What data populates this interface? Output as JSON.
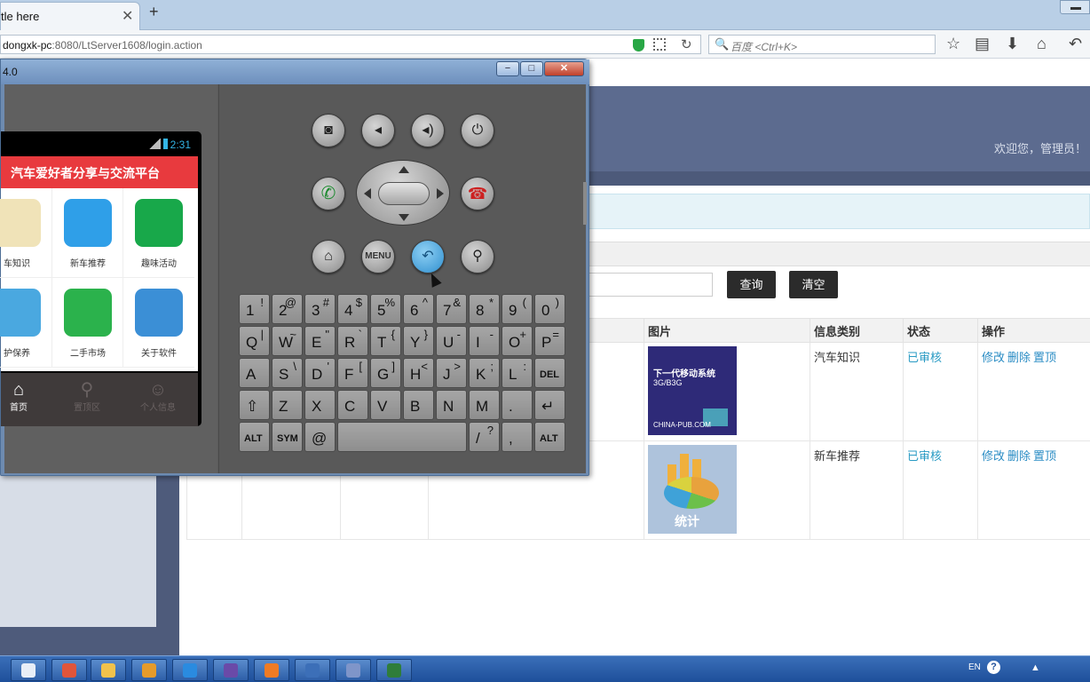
{
  "browser": {
    "tab_title": "tle here",
    "tab_close": "✕",
    "new_tab": "+",
    "url_host": "dongxk-pc",
    "url_path": ":8080/LtServer1608/login.action",
    "search_placeholder": "百度 <Ctrl+K>",
    "icons": [
      "shield-icon",
      "qr-icon",
      "reload-icon",
      "search-icon",
      "star-icon",
      "reading-list-icon",
      "download-icon",
      "home-icon",
      "back-icon"
    ]
  },
  "page": {
    "welcome": "欢迎您，管理员！",
    "buttons": {
      "query": "查询",
      "clear": "清空"
    },
    "table": {
      "headers": [
        "图片",
        "信息类别",
        "状态",
        "操作"
      ],
      "rows": [
        {
          "category": "汽车知识",
          "status": "已审核",
          "ops": [
            "修改",
            "删除",
            "置顶"
          ],
          "thumb": {
            "title": "下一代移动系统",
            "subtitle": "3G/B3G",
            "footer": "CHINA-PUB.COM"
          }
        },
        {
          "category": "新车推荐",
          "status": "已审核",
          "ops": [
            "修改",
            "删除",
            "置顶"
          ],
          "thumb": {
            "label": "统计"
          }
        }
      ]
    }
  },
  "emulator": {
    "title": "4.0",
    "window_buttons": {
      "minimize": "−",
      "maximize": "□",
      "close": "✕"
    },
    "phone": {
      "time": "2:31",
      "header": "汽车爱好者分享与交流平台",
      "grid": [
        {
          "label": "车知识",
          "icon": "cartoon-icon",
          "color": "#f0e3b8"
        },
        {
          "label": "新车推荐",
          "icon": "bird-icon",
          "color": "#2f9fe8"
        },
        {
          "label": "趣味活动",
          "icon": "tc-icon",
          "color": "#18a84a"
        },
        {
          "label": "护保养",
          "icon": "pinwheel-icon",
          "color": "#4aa8e0"
        },
        {
          "label": "二手市场",
          "icon": "cube-icon",
          "color": "#2bb24c"
        },
        {
          "label": "关于软件",
          "icon": "box-icon",
          "color": "#3b8fd6"
        }
      ],
      "tabs": [
        {
          "label": "首页",
          "icon": "home-icon"
        },
        {
          "label": "置顶区",
          "icon": "search-icon"
        },
        {
          "label": "个人信息",
          "icon": "person-icon"
        }
      ]
    },
    "hw_buttons": {
      "row1": [
        "camera-icon",
        "volume-down-icon",
        "volume-up-icon",
        "power-icon"
      ],
      "row2": [
        "call-icon",
        "end-call-icon"
      ],
      "row3": [
        "home-icon",
        "menu-button",
        "back-icon",
        "search-icon"
      ],
      "menu_label": "MENU"
    },
    "keyboard": {
      "row1": [
        [
          "1",
          "!"
        ],
        [
          "2",
          "@"
        ],
        [
          "3",
          "#"
        ],
        [
          "4",
          "$"
        ],
        [
          "5",
          "%"
        ],
        [
          "6",
          "^"
        ],
        [
          "7",
          "&"
        ],
        [
          "8",
          "*"
        ],
        [
          "9",
          "("
        ],
        [
          "0",
          ")"
        ]
      ],
      "row2": [
        [
          "Q",
          "|"
        ],
        [
          "W",
          "~"
        ],
        [
          "E",
          "\""
        ],
        [
          "R",
          "`"
        ],
        [
          "T",
          "{"
        ],
        [
          "Y",
          "}"
        ],
        [
          "U",
          "-"
        ],
        [
          "I",
          "-"
        ],
        [
          "O",
          "+"
        ],
        [
          "P",
          "="
        ]
      ],
      "row3": [
        [
          "A",
          ""
        ],
        [
          "S",
          "\\"
        ],
        [
          "D",
          "'"
        ],
        [
          "F",
          "["
        ],
        [
          "G",
          "]"
        ],
        [
          "H",
          "<"
        ],
        [
          "J",
          ">"
        ],
        [
          "K",
          ";"
        ],
        [
          "L",
          ":"
        ],
        [
          "DEL",
          ""
        ]
      ],
      "row4": [
        [
          "⇧",
          ""
        ],
        [
          "Z",
          ""
        ],
        [
          "X",
          ""
        ],
        [
          "C",
          ""
        ],
        [
          "V",
          ""
        ],
        [
          "B",
          ""
        ],
        [
          "N",
          ""
        ],
        [
          "M",
          ""
        ],
        [
          ".",
          ""
        ],
        [
          "↵",
          ""
        ]
      ],
      "row5": [
        [
          "ALT",
          ""
        ],
        [
          "SYM",
          ""
        ],
        [
          "@",
          ""
        ],
        [
          "space",
          ""
        ],
        [
          "/",
          "?"
        ],
        [
          ",",
          ""
        ],
        [
          "ALT",
          ""
        ]
      ]
    }
  },
  "taskbar": {
    "apps": [
      "document-icon",
      "paint-icon",
      "explorer-icon",
      "book-icon",
      "ie-icon",
      "eclipse-icon",
      "firefox-icon",
      "tool-icon",
      "disk-icon",
      "android-icon"
    ],
    "tray_lang": "EN",
    "tray_help": "?"
  }
}
